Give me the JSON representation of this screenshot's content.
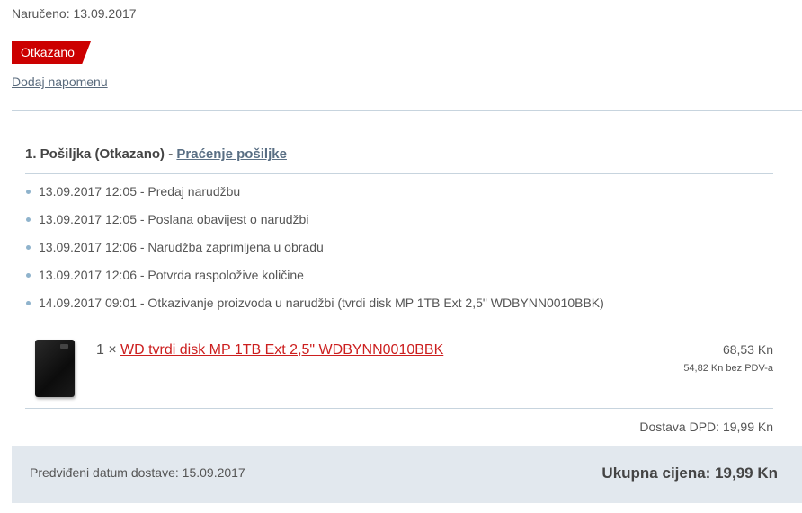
{
  "order": {
    "ordered_date": "Naručeno: 13.09.2017",
    "status": "Otkazano",
    "add_note": "Dodaj napomenu"
  },
  "shipment": {
    "title": "1. Pošiljka (Otkazano) -",
    "tracking_link": "Praćenje pošiljke",
    "events": [
      "13.09.2017 12:05 - Predaj narudžbu",
      "13.09.2017 12:05 - Poslana obavijest o narudžbi",
      "13.09.2017 12:06 - Narudžba zaprimljena u obradu",
      "13.09.2017 12:06 - Potvrda raspoložive količine",
      "14.09.2017 09:01 - Otkazivanje proizvoda u narudžbi (tvrdi disk MP 1TB Ext 2,5\" WDBYNN0010BBK)"
    ],
    "item": {
      "quantity": "1 ×",
      "name": "WD tvrdi disk MP 1TB Ext 2,5\" WDBYNN0010BBK",
      "price": "68,53 Kn",
      "price_net": "54,82 Kn bez PDV-a"
    },
    "shipping": "Dostava DPD: 19,99 Kn"
  },
  "footer": {
    "delivery_date": "Predviđeni datum dostave: 15.09.2017",
    "total": "Ukupna cijena: 19,99 Kn"
  },
  "colors": {
    "status_badge": "#cc0000",
    "product_link": "#cc1f1f",
    "footer_bg": "#e2e8ee",
    "divider": "#c7d4de"
  }
}
